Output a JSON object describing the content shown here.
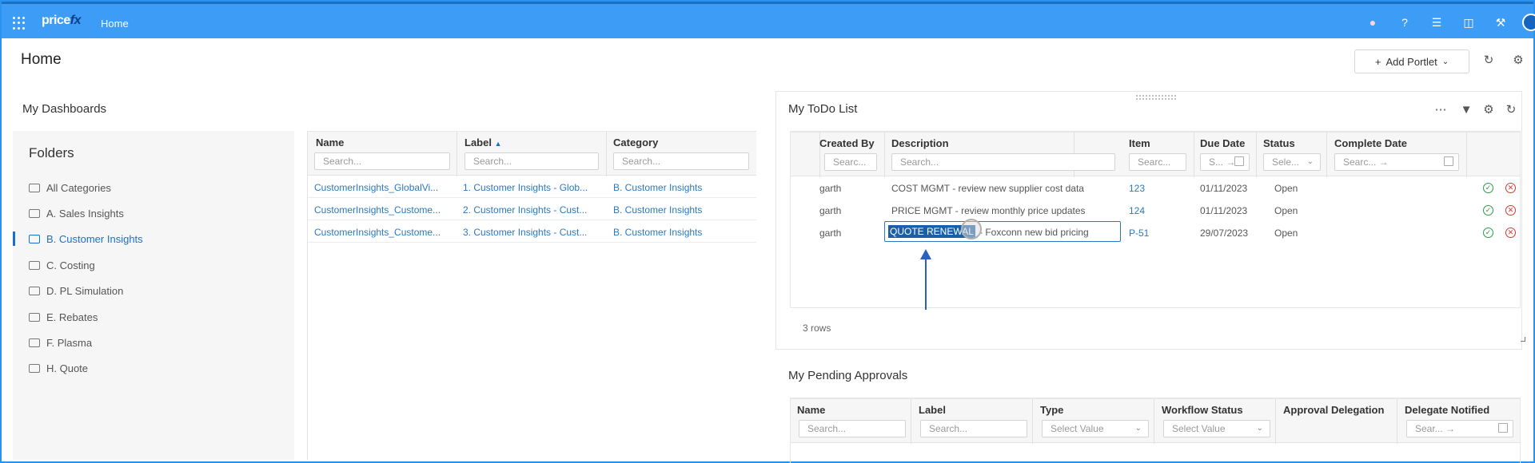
{
  "topbar": {
    "logo_main": "price",
    "logo_fx": "fx",
    "home_label": "Home"
  },
  "page": {
    "title": "Home",
    "add_portlet_label": "Add Portlet"
  },
  "dashboards": {
    "title": "My Dashboards",
    "folders_title": "Folders",
    "folders": [
      {
        "label": "All Categories",
        "active": false
      },
      {
        "label": "A. Sales Insights",
        "active": false
      },
      {
        "label": "B. Customer Insights",
        "active": true
      },
      {
        "label": "C. Costing",
        "active": false
      },
      {
        "label": "D. PL Simulation",
        "active": false
      },
      {
        "label": "E. Rebates",
        "active": false
      },
      {
        "label": "F. Plasma",
        "active": false
      },
      {
        "label": "H. Quote",
        "active": false
      }
    ],
    "columns": {
      "name": "Name",
      "label": "Label",
      "category": "Category",
      "search_placeholder": "Search..."
    },
    "rows": [
      {
        "name": "CustomerInsights_GlobalVi...",
        "label": "1. Customer Insights - Glob...",
        "category": "B. Customer Insights"
      },
      {
        "name": "CustomerInsights_Custome...",
        "label": "2. Customer Insights - Cust...",
        "category": "B. Customer Insights"
      },
      {
        "name": "CustomerInsights_Custome...",
        "label": "3. Customer Insights - Cust...",
        "category": "B. Customer Insights"
      }
    ]
  },
  "todo": {
    "title": "My ToDo List",
    "columns": {
      "created_by": "Created By",
      "description": "Description",
      "item": "Item",
      "due_date": "Due Date",
      "status": "Status",
      "complete_date": "Complete Date"
    },
    "placeholders": {
      "created_by": "Searc...",
      "description": "Search...",
      "item": "Searc...",
      "due_date": "S... →",
      "status": "Sele...",
      "complete_date": "Searc... →"
    },
    "rows": [
      {
        "created_by": "garth",
        "description": "COST MGMT - review new supplier cost data",
        "item": "123",
        "due_date": "01/11/2023",
        "status": "Open"
      },
      {
        "created_by": "garth",
        "description": "PRICE MGMT - review monthly price updates",
        "item": "124",
        "due_date": "01/11/2023",
        "status": "Open"
      },
      {
        "created_by": "garth",
        "description_selected": "QUOTE RENEWAL",
        "description_rest": "- Foxconn new bid pricing",
        "item": "P-51",
        "due_date": "29/07/2023",
        "status": "Open"
      }
    ],
    "rows_count": "3 rows"
  },
  "approvals": {
    "title": "My Pending Approvals",
    "columns": {
      "name": "Name",
      "label": "Label",
      "type": "Type",
      "workflow_status": "Workflow Status",
      "approval_delegation": "Approval Delegation",
      "delegate_notified": "Delegate Notified"
    },
    "placeholders": {
      "name": "Search...",
      "label": "Search...",
      "type": "Select Value",
      "workflow_status": "Select Value",
      "delegate_notified": "Sear... →"
    }
  },
  "colors": {
    "topbar": "#3d9cf5",
    "accent": "#1b6fcb",
    "ok": "#2e9b47",
    "danger": "#dd3333"
  }
}
